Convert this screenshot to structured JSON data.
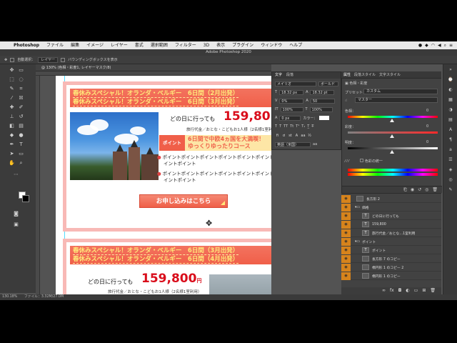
{
  "menubar": {
    "apple": "",
    "items": [
      "Photoshop",
      "ファイル",
      "編集",
      "イメージ",
      "レイヤー",
      "書式",
      "選択範囲",
      "フィルター",
      "3D",
      "表示",
      "プラグイン",
      "ウィンドウ",
      "ヘルプ"
    ]
  },
  "window": {
    "title": "Adobe Photoshop 2020"
  },
  "options_bar": {
    "auto_select": "自動選択：",
    "layer_select": "レイヤー",
    "bounding_box": "バウンディングボックスを表示"
  },
  "document_tab": {
    "label": "@ 130% (色相・彩度1, レイヤーマスク/8)"
  },
  "document": {
    "card1": {
      "header_line1": "春休みスペシャル！オランダ・ベルギー　6日間（2月出発）",
      "header_line2": "春休みスペシャル！オランダ・ベルギー　6日間（3月出発）",
      "ask": "どの日に行っても",
      "price": "159,80",
      "note": "旅行代金／おとな・こどもお1人様（2名様1室利用）",
      "point_label": "ポイント",
      "point_line1": "6日間で中欧4ヵ国を大満喫！",
      "point_line2": "ゆっくりゆったりコース",
      "bullet1a": "ポイントポイントポイントポイントポイントポイントポ",
      "bullet1b": "イントポイント",
      "bullet2a": "ポイントポイントポイントポイントポイントポイントポ",
      "bullet2b": "イントポイント",
      "apply": "お申し込みはこちら"
    },
    "card2": {
      "header_line1": "春休みスペシャル！オランダ・ベルギー　6日間（3月出発）",
      "header_line2": "春休みスペシャル！オランダ・ベルギー　6日間（4月出発）",
      "ask": "どの日に行っても",
      "price": "159,800",
      "yen": "円",
      "note": "旅行代金／おとな・こどもお1人様（2名様1室利用）"
    }
  },
  "character_panel": {
    "tab_character": "文字",
    "tab_paragraph": "段落",
    "font_family": "メイリオ",
    "font_style": "ボールド",
    "font_size": "18.32 px",
    "leading": "18.32 pt",
    "kerning": "0%",
    "tracking": "50",
    "vertical_scale": "100%",
    "horizontal_scale": "100%",
    "baseline": "0 px",
    "color_label": "カラー：",
    "language": "英語（米国）"
  },
  "properties_panel": {
    "tabs": [
      "属性",
      "段落スタイル",
      "文字スタイル"
    ],
    "title": "色相・彩度",
    "preset_label": "プリセット：",
    "preset_value": "カスタム",
    "channel": "マスター",
    "hue_label": "色相：",
    "hue_value": "0",
    "saturation_label": "彩度：",
    "saturation_value": "0",
    "lightness_label": "明度：",
    "lightness_value": "0",
    "colorize": "色彩の統一"
  },
  "layers": [
    {
      "name": "長方形 2",
      "kind": "shape"
    },
    {
      "name": "価格",
      "kind": "group"
    },
    {
      "name": "どの日に行っても",
      "kind": "text"
    },
    {
      "name": "159,800",
      "kind": "text"
    },
    {
      "name": "旅行代金／おとな…1室利用",
      "kind": "text"
    },
    {
      "name": "ポイント",
      "kind": "group"
    },
    {
      "name": "ポイント",
      "kind": "text"
    },
    {
      "name": "長方形 7 のコピー",
      "kind": "shape"
    },
    {
      "name": "楕円形 1 のコピー 2",
      "kind": "shape"
    },
    {
      "name": "楕円形 1 のコピー",
      "kind": "shape"
    }
  ],
  "status_bar": {
    "zoom": "130.18%",
    "file_info": "ファイル：3.32M/27.0M"
  },
  "colors": {
    "accent_red": "#f05f49",
    "price_red": "#d90d1b",
    "card_border": "#f8b9b6",
    "point_bg": "#fde6a6",
    "layer_eye": "#d6831c"
  }
}
